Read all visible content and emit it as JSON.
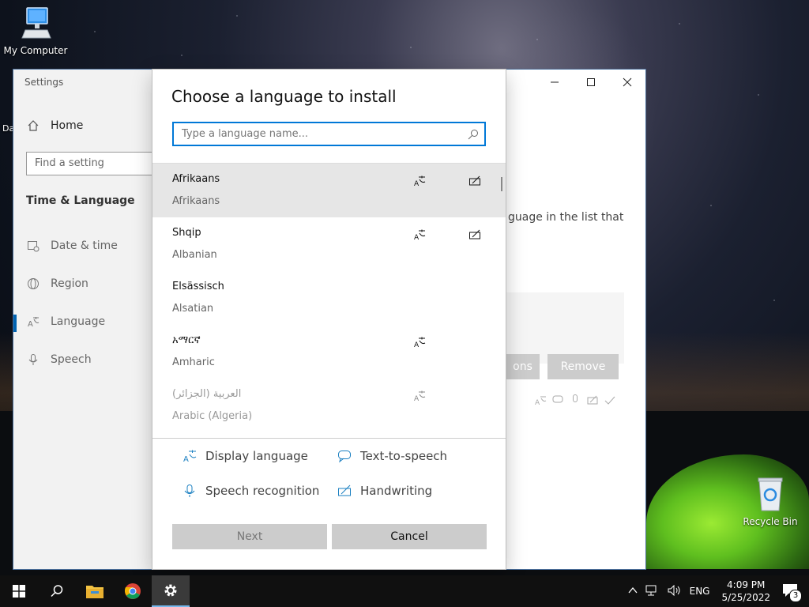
{
  "desktop": {
    "my_computer": "My Computer",
    "recycle_bin": "Recycle Bin",
    "partial_label": "Da"
  },
  "settings": {
    "title": "Settings",
    "home": "Home",
    "find_placeholder": "Find a setting",
    "section": "Time & Language",
    "nav": [
      {
        "label": "Date & time",
        "icon": "calendar-clock-icon"
      },
      {
        "label": "Region",
        "icon": "globe-icon"
      },
      {
        "label": "Language",
        "icon": "language-icon",
        "selected": true
      },
      {
        "label": "Speech",
        "icon": "microphone-icon"
      }
    ],
    "bg_text": "guage in the list that",
    "bg_options": "ons",
    "bg_remove": "Remove"
  },
  "dialog": {
    "title": "Choose a language to install",
    "search_placeholder": "Type a language name...",
    "languages": [
      {
        "native": "Afrikaans",
        "english": "Afrikaans",
        "display": true,
        "handwriting": true
      },
      {
        "native": "Shqip",
        "english": "Albanian",
        "display": true,
        "handwriting": true
      },
      {
        "native": "Elsässisch",
        "english": "Alsatian",
        "display": false,
        "handwriting": false
      },
      {
        "native": "አማርኛ",
        "english": "Amharic",
        "display": true,
        "handwriting": false
      },
      {
        "native": "العربية (الجزائر)",
        "english": "Arabic (Algeria)",
        "display": true,
        "handwriting": false
      }
    ],
    "legend": {
      "display_language": "Display language",
      "text_to_speech": "Text-to-speech",
      "speech_recognition": "Speech recognition",
      "handwriting": "Handwriting"
    },
    "next": "Next",
    "cancel": "Cancel"
  },
  "taskbar": {
    "lang": "ENG",
    "time": "4:09 PM",
    "date": "5/25/2022",
    "notification_count": "3"
  },
  "colors": {
    "accent": "#0078d7",
    "legend_icon": "#1a7fc1"
  }
}
